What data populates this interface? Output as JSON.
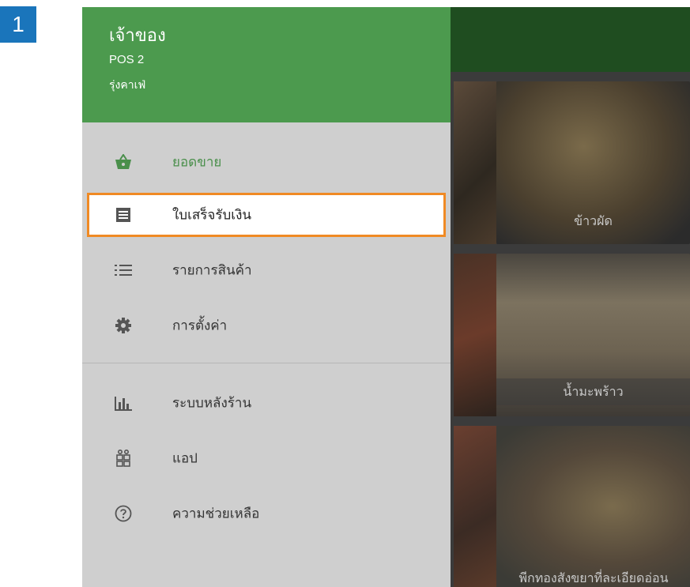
{
  "step": {
    "number": "1"
  },
  "drawer": {
    "owner": "เจ้าของ",
    "device": "POS 2",
    "store": "รุ่งคาเฟ่",
    "items": [
      {
        "label": "ยอดขาย",
        "icon": "shopping-basket-icon",
        "active": true
      },
      {
        "label": "ใบเสร็จรับเงิน",
        "icon": "receipt-icon",
        "highlighted": true
      },
      {
        "label": "รายการสินค้า",
        "icon": "list-icon"
      },
      {
        "label": "การตั้งค่า",
        "icon": "gear-icon"
      },
      {
        "label": "ระบบหลังร้าน",
        "icon": "bar-chart-icon"
      },
      {
        "label": "แอป",
        "icon": "apps-icon"
      },
      {
        "label": "ความช่วยเหลือ",
        "icon": "help-icon"
      }
    ]
  },
  "items_grid": {
    "cards": [
      {
        "name": "ข้าวผัด"
      },
      {
        "name": "น้ำมะพร้าว"
      },
      {
        "name": "พีกทองสังขยาที่ละเอียดอ่อน"
      }
    ]
  },
  "colors": {
    "header_green": "#4c9a4e",
    "active_green": "#4a8f4b",
    "highlight_outline": "#f08a24",
    "step_badge": "#1a75bb"
  }
}
